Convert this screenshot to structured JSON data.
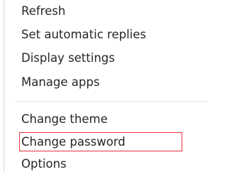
{
  "menu": {
    "items": [
      {
        "label": "Refresh"
      },
      {
        "label": "Set automatic replies"
      },
      {
        "label": "Display settings"
      },
      {
        "label": "Manage apps"
      },
      {
        "label": "Change theme"
      },
      {
        "label": "Change password"
      },
      {
        "label": "Options"
      }
    ],
    "highlighted_item": "Change password",
    "highlight_color": "#e8303a",
    "text_color": "#262626"
  }
}
